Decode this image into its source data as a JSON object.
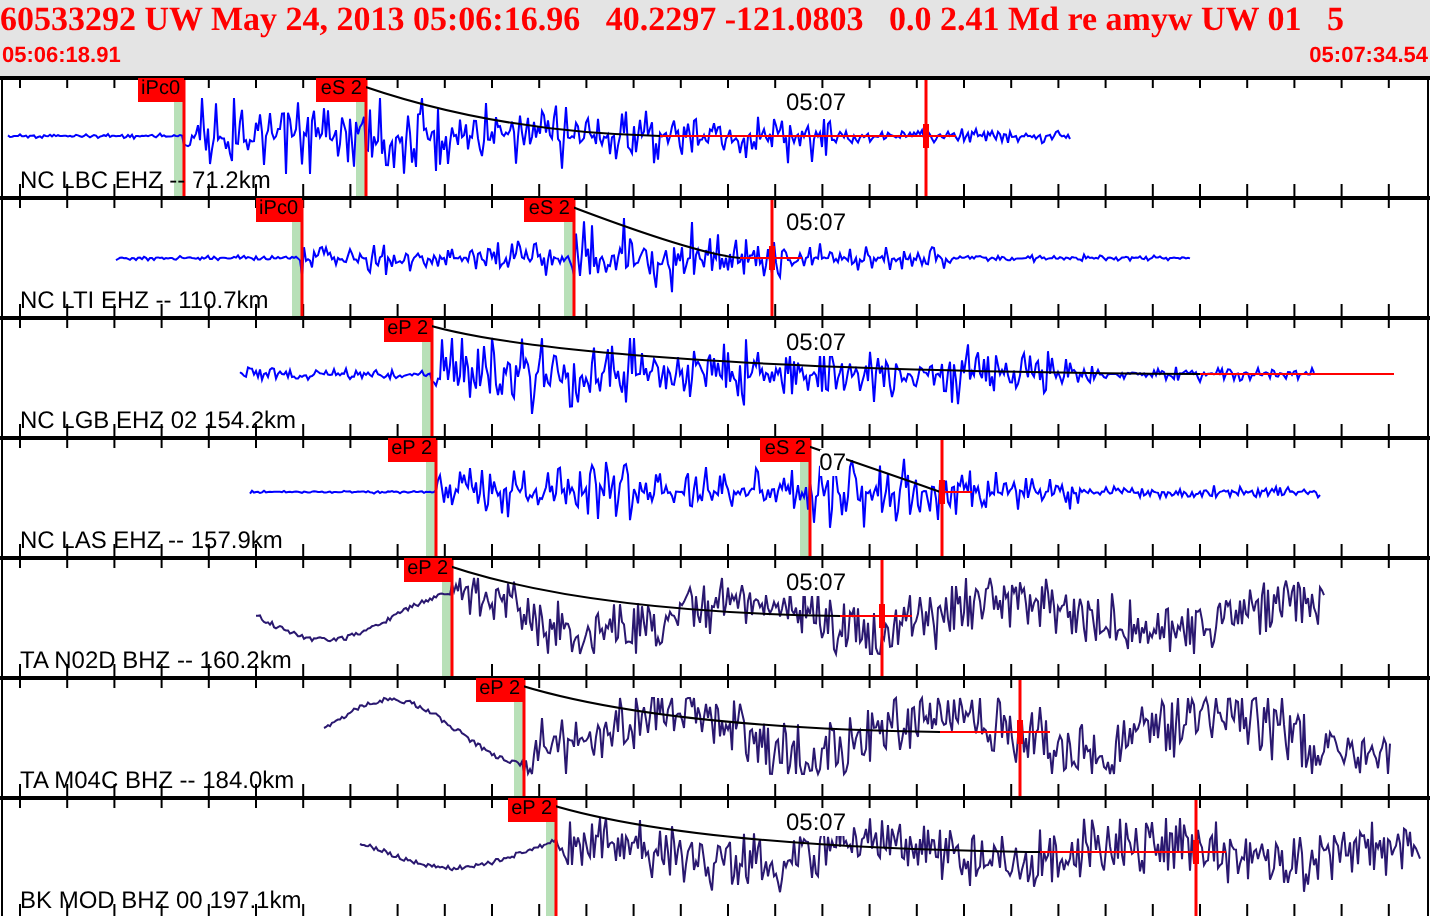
{
  "header": {
    "title": "60533292 UW May 24, 2013 05:06:16.96   40.2297 -121.0803   0.0 2.41 Md re amyw UW 01   5",
    "start_time": "05:06:18.91",
    "end_time": "05:07:34.54"
  },
  "panels": [
    {
      "station": "NC LBC EHZ -- 71.2km",
      "time_label": "05:07",
      "picks": [
        {
          "label": "iPc0"
        },
        {
          "label": "eS 2"
        }
      ]
    },
    {
      "station": "NC LTI EHZ -- 110.7km",
      "time_label": "05:07",
      "picks": [
        {
          "label": "iPc0"
        },
        {
          "label": "eS 2"
        }
      ]
    },
    {
      "station": "NC LGB EHZ 02 154.2km",
      "time_label": "05:07",
      "picks": [
        {
          "label": "eP 2"
        }
      ]
    },
    {
      "station": "NC LAS EHZ -- 157.9km",
      "time_label": "07",
      "picks": [
        {
          "label": "eP 2"
        },
        {
          "label": "eS 2"
        }
      ]
    },
    {
      "station": "TA N02D BHZ -- 160.2km",
      "time_label": "05:07",
      "picks": [
        {
          "label": "eP 2"
        }
      ]
    },
    {
      "station": "TA M04C BHZ -- 184.0km",
      "picks": [
        {
          "label": "eP 2"
        }
      ]
    },
    {
      "station": "BK MOD BHZ 00 197.1km",
      "time_label": "05:07",
      "picks": [
        {
          "label": "eP 2"
        }
      ]
    }
  ]
}
